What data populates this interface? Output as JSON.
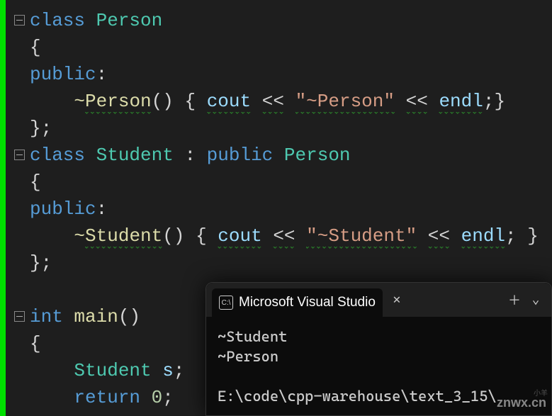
{
  "code": {
    "lines": [
      {
        "tokens": [
          [
            "kw",
            "class"
          ],
          [
            "sp",
            " "
          ],
          [
            "type",
            "Person"
          ]
        ]
      },
      {
        "tokens": [
          [
            "punct",
            "{"
          ]
        ]
      },
      {
        "tokens": [
          [
            "kw",
            "public"
          ],
          [
            "punct",
            ":"
          ]
        ]
      },
      {
        "tokens": [
          [
            "indent",
            "    "
          ],
          [
            "tilde",
            "~"
          ],
          [
            "func_sq",
            "Person"
          ],
          [
            "punct",
            "()"
          ],
          [
            "sp",
            " "
          ],
          [
            "punct",
            "{"
          ],
          [
            "sp",
            " "
          ],
          [
            "var_sq",
            "cout"
          ],
          [
            "sp",
            " "
          ],
          [
            "punct_sq",
            "<<"
          ],
          [
            "sp",
            " "
          ],
          [
            "str_sq",
            "\"~Person\""
          ],
          [
            "sp",
            " "
          ],
          [
            "punct_sq",
            "<<"
          ],
          [
            "sp",
            " "
          ],
          [
            "var_sq",
            "endl"
          ],
          [
            "punct",
            ";"
          ],
          [
            "punct",
            "}"
          ]
        ]
      },
      {
        "tokens": [
          [
            "punct",
            "};"
          ]
        ]
      },
      {
        "tokens": [
          [
            "kw",
            "class"
          ],
          [
            "sp",
            " "
          ],
          [
            "type",
            "Student"
          ],
          [
            "sp",
            " "
          ],
          [
            "punct",
            ":"
          ],
          [
            "sp",
            " "
          ],
          [
            "kw",
            "public"
          ],
          [
            "sp",
            " "
          ],
          [
            "type",
            "Person"
          ]
        ]
      },
      {
        "tokens": [
          [
            "punct",
            "{"
          ]
        ]
      },
      {
        "tokens": [
          [
            "kw",
            "public"
          ],
          [
            "punct",
            ":"
          ]
        ]
      },
      {
        "tokens": [
          [
            "indent",
            "    "
          ],
          [
            "tilde",
            "~"
          ],
          [
            "func_sq",
            "Student"
          ],
          [
            "punct",
            "()"
          ],
          [
            "sp",
            " "
          ],
          [
            "punct",
            "{"
          ],
          [
            "sp",
            " "
          ],
          [
            "var_sq",
            "cout"
          ],
          [
            "sp",
            " "
          ],
          [
            "punct_sq",
            "<<"
          ],
          [
            "sp",
            " "
          ],
          [
            "str_sq",
            "\"~Student\""
          ],
          [
            "sp",
            " "
          ],
          [
            "punct_sq",
            "<<"
          ],
          [
            "sp",
            " "
          ],
          [
            "var_sq",
            "endl"
          ],
          [
            "punct",
            ";"
          ],
          [
            "sp",
            " "
          ],
          [
            "punct",
            "}"
          ]
        ]
      },
      {
        "tokens": [
          [
            "punct",
            "};"
          ]
        ]
      },
      {
        "tokens": []
      },
      {
        "tokens": [
          [
            "kw",
            "int"
          ],
          [
            "sp",
            " "
          ],
          [
            "func",
            "main"
          ],
          [
            "punct",
            "()"
          ]
        ]
      },
      {
        "tokens": [
          [
            "punct",
            "{"
          ]
        ]
      },
      {
        "tokens": [
          [
            "indent",
            "    "
          ],
          [
            "type",
            "Student"
          ],
          [
            "sp",
            " "
          ],
          [
            "var",
            "s"
          ],
          [
            "punct",
            ";"
          ]
        ]
      },
      {
        "tokens": [
          [
            "indent",
            "    "
          ],
          [
            "kw",
            "return"
          ],
          [
            "sp",
            " "
          ],
          [
            "num",
            "0"
          ],
          [
            "punct",
            ";"
          ]
        ]
      }
    ],
    "folds": [
      0,
      5,
      11
    ]
  },
  "terminal": {
    "title": "Microsoft Visual Studio",
    "icon_text": "C:\\",
    "output_lines": [
      "~Student",
      "~Person",
      "",
      "E:\\code\\cpp-warehouse\\text_3_15\\"
    ]
  },
  "watermarks": {
    "main": "znwx.cn",
    "small": "小羊"
  }
}
